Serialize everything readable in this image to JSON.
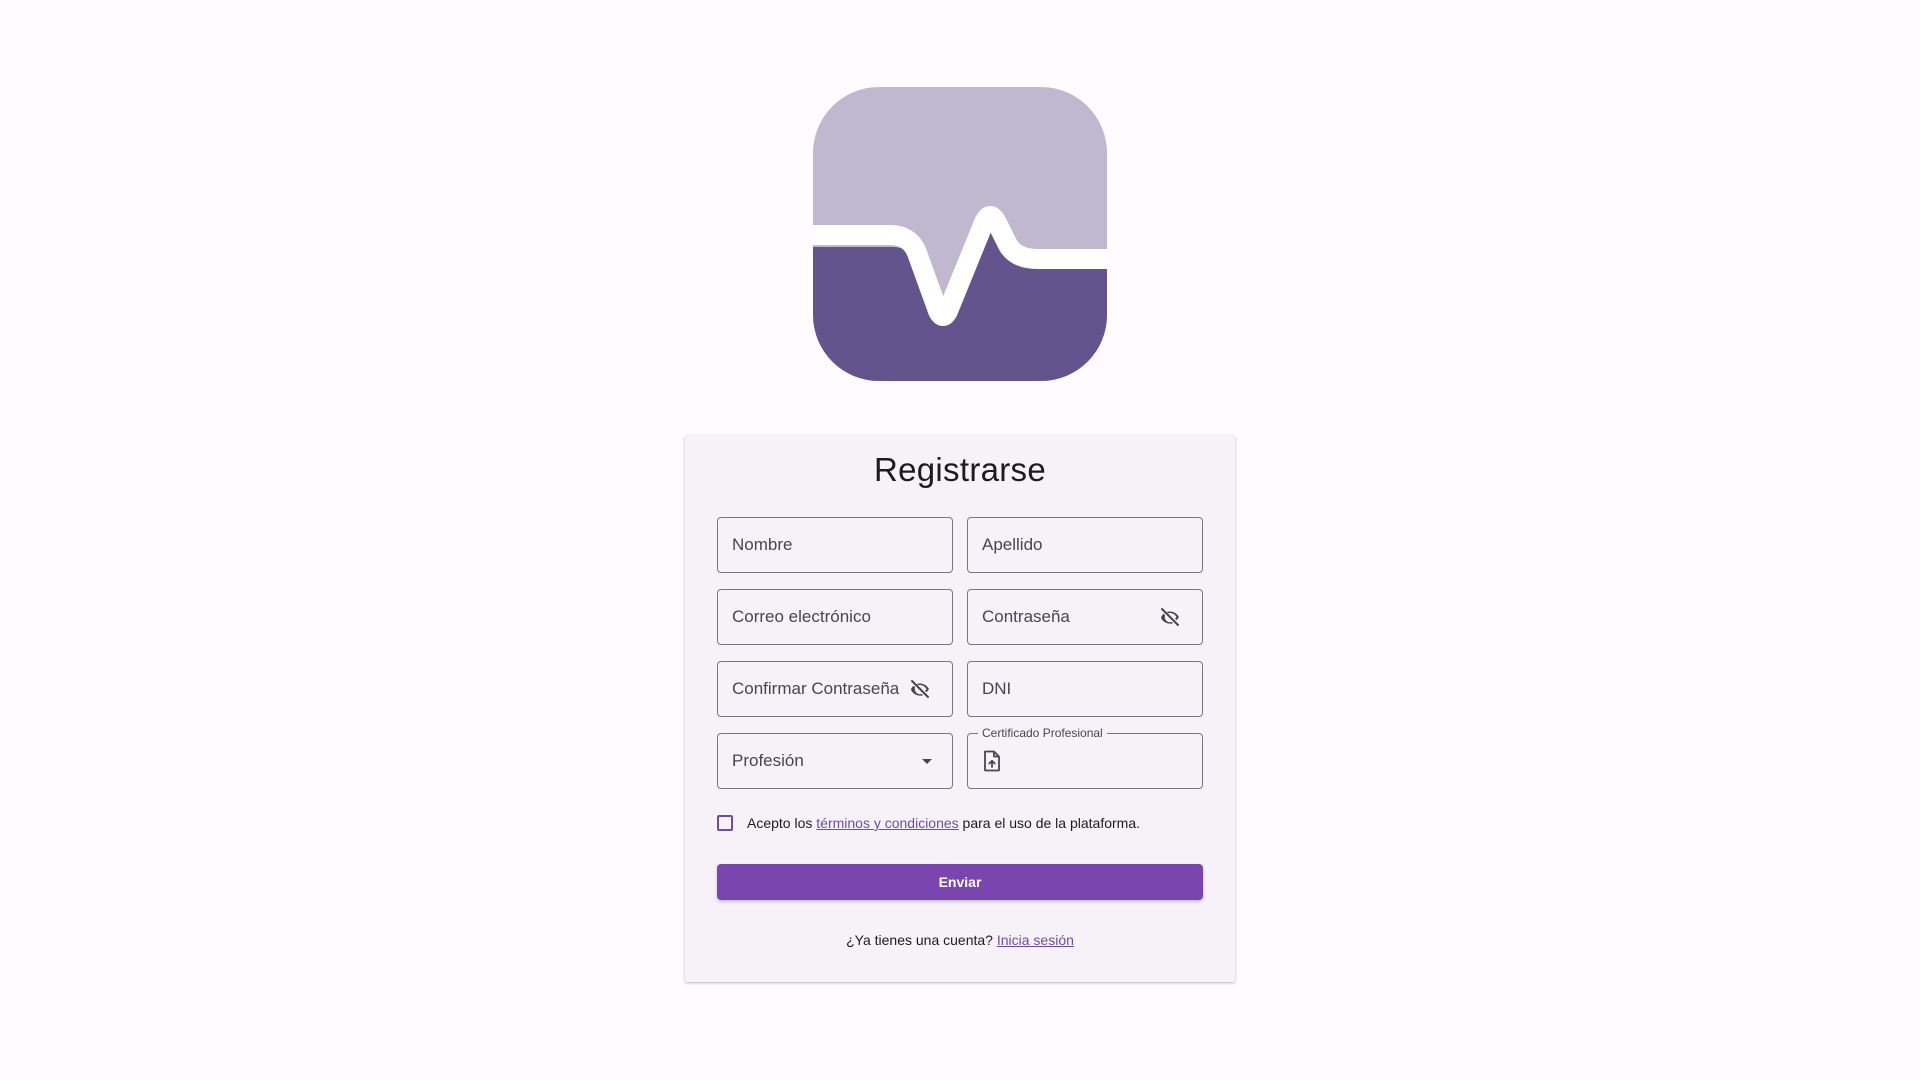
{
  "colors": {
    "background": "#fffbff",
    "card": "#f7f2f8",
    "primary_button": "#7b45b0",
    "link": "#6a4fa3",
    "logo_light": "#bfb8cf",
    "logo_dark": "#64548e"
  },
  "logo": {
    "icon": "heartbeat-pulse-logo"
  },
  "form": {
    "title": "Registrarse",
    "fields": {
      "first_name": "Nombre",
      "last_name": "Apellido",
      "email": "Correo electrónico",
      "password": "Contraseña",
      "confirm_password": "Confirmar Contraseña",
      "dni": "DNI",
      "profession": "Profesión",
      "certificate": "Certificado Profesional"
    },
    "icons": {
      "password_toggle": "visibility-off-icon",
      "profession_dropdown": "arrow-drop-down-icon",
      "certificate_upload": "file-upload-icon"
    },
    "terms": {
      "prefix": "Acepto los ",
      "link": "términos y condiciones",
      "suffix": " para el uso de la plataforma.",
      "checked": false
    },
    "submit_label": "Enviar",
    "login": {
      "prompt": "¿Ya tienes una cuenta? ",
      "link": "Inicia sesión"
    }
  }
}
